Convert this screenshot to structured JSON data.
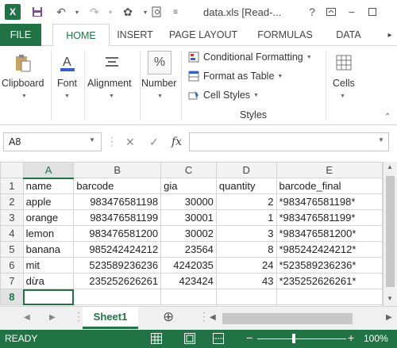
{
  "titlebar": {
    "app_icon": "X",
    "title": "data.xls  [Read-...",
    "quick_access": [
      "save-icon",
      "undo-icon",
      "redo-icon",
      "paint-icon",
      "preview-icon",
      "more-icon"
    ],
    "window_controls": [
      "help-icon",
      "restore-ribbon-icon",
      "minimize-icon",
      "maximize-icon"
    ]
  },
  "ribbon_tabs": {
    "file": "FILE",
    "items": [
      "HOME",
      "INSERT",
      "PAGE LAYOUT",
      "FORMULAS",
      "DATA"
    ]
  },
  "ribbon": {
    "clipboard": "Clipboard",
    "font": "Font",
    "alignment": "Alignment",
    "number": "Number",
    "number_icon": "%",
    "conditional_formatting": "Conditional Formatting",
    "format_as_table": "Format as Table",
    "cell_styles": "Cell Styles",
    "styles_group": "Styles",
    "cells": "Cells"
  },
  "formula_bar": {
    "name_box": "A8",
    "fx": "fx",
    "value": ""
  },
  "grid": {
    "columns": [
      "A",
      "B",
      "C",
      "D",
      "E"
    ],
    "rows": [
      {
        "num": "1",
        "cells": [
          "name",
          "barcode",
          "gia",
          "quantity",
          "barcode_final"
        ]
      },
      {
        "num": "2",
        "cells": [
          "apple",
          "983476581198",
          "30000",
          "2",
          "*983476581198*"
        ]
      },
      {
        "num": "3",
        "cells": [
          "orange",
          "983476581199",
          "30001",
          "1",
          "*983476581199*"
        ]
      },
      {
        "num": "4",
        "cells": [
          "lemon",
          "983476581200",
          "30002",
          "3",
          "*983476581200*"
        ]
      },
      {
        "num": "5",
        "cells": [
          "banana",
          "985242424212",
          "23564",
          "8",
          "*985242424212*"
        ]
      },
      {
        "num": "6",
        "cells": [
          "mit",
          "523589236236",
          "4242035",
          "24",
          "*523589236236*"
        ]
      },
      {
        "num": "7",
        "cells": [
          "dừa",
          "235252626261",
          "423424",
          "43",
          "*235252626261*"
        ]
      },
      {
        "num": "8",
        "cells": [
          "",
          "",
          "",
          "",
          ""
        ]
      }
    ],
    "selected_cell": "A8"
  },
  "sheets": {
    "active": "Sheet1",
    "add": "⊕"
  },
  "status": {
    "ready": "READY",
    "zoom": "100%",
    "zoom_minus": "−",
    "zoom_plus": "+"
  },
  "colors": {
    "accent": "#217346"
  }
}
